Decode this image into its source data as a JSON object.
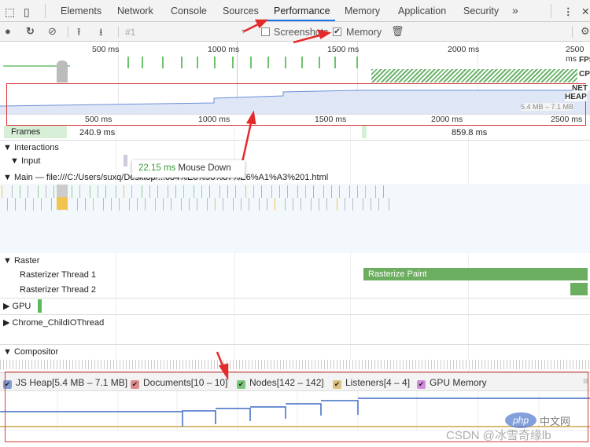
{
  "tabs": [
    {
      "label": "Elements"
    },
    {
      "label": "Network"
    },
    {
      "label": "Console"
    },
    {
      "label": "Sources"
    },
    {
      "label": "Performance",
      "active": true
    },
    {
      "label": "Memory"
    },
    {
      "label": "Application"
    },
    {
      "label": "Security"
    }
  ],
  "tabs_more": "»",
  "toolbar": {
    "profile": "#1",
    "screenshots_label": "Screenshots",
    "screenshots_checked": false,
    "memory_label": "Memory",
    "memory_checked": true
  },
  "overview": {
    "ticks": [
      "500 ms",
      "1000 ms",
      "1500 ms",
      "2000 ms",
      "2500 ms"
    ],
    "fps_label": "FPS",
    "cpu_label": "CPU",
    "net_label": "NET",
    "heap_label": "HEAP",
    "heap_range": "5.4 MB – 7.1 MB"
  },
  "ruler": {
    "ticks": [
      "500 ms",
      "1000 ms",
      "1500 ms",
      "2000 ms",
      "2500 ms"
    ]
  },
  "tracks": {
    "frames": "Frames",
    "frame_time_1": "240.9 ms",
    "frame_time_2": "859.8 ms",
    "interactions": "Interactions",
    "input": "Input",
    "main": "Main — file:///C:/Users/suxq/Desktop/...684%E6%96%87%E6%A1%A3%201.html",
    "raster": "Raster",
    "raster1": "Rasterizer Thread 1",
    "raster2": "Rasterizer Thread 2",
    "rasterize_paint": "Rasterize Paint",
    "gpu": "GPU",
    "io": "Chrome_ChildIOThread",
    "compositor": "Compositor"
  },
  "tooltip": {
    "time": "22.15 ms",
    "label": "Mouse Down"
  },
  "legend": [
    {
      "label": "JS Heap[5.4 MB – 7.1 MB]",
      "color": "#4a72c4"
    },
    {
      "label": "Documents[10 – 10]",
      "color": "#d45a5a"
    },
    {
      "label": "Nodes[142 – 142]",
      "color": "#3db33d"
    },
    {
      "label": "Listeners[4 – 4]",
      "color": "#d1a84a"
    },
    {
      "label": "GPU Memory",
      "color": "#c25ad1"
    }
  ],
  "watermark": {
    "logo": "php 中文网",
    "text": "CSDN @冰雪奇缘lb"
  }
}
